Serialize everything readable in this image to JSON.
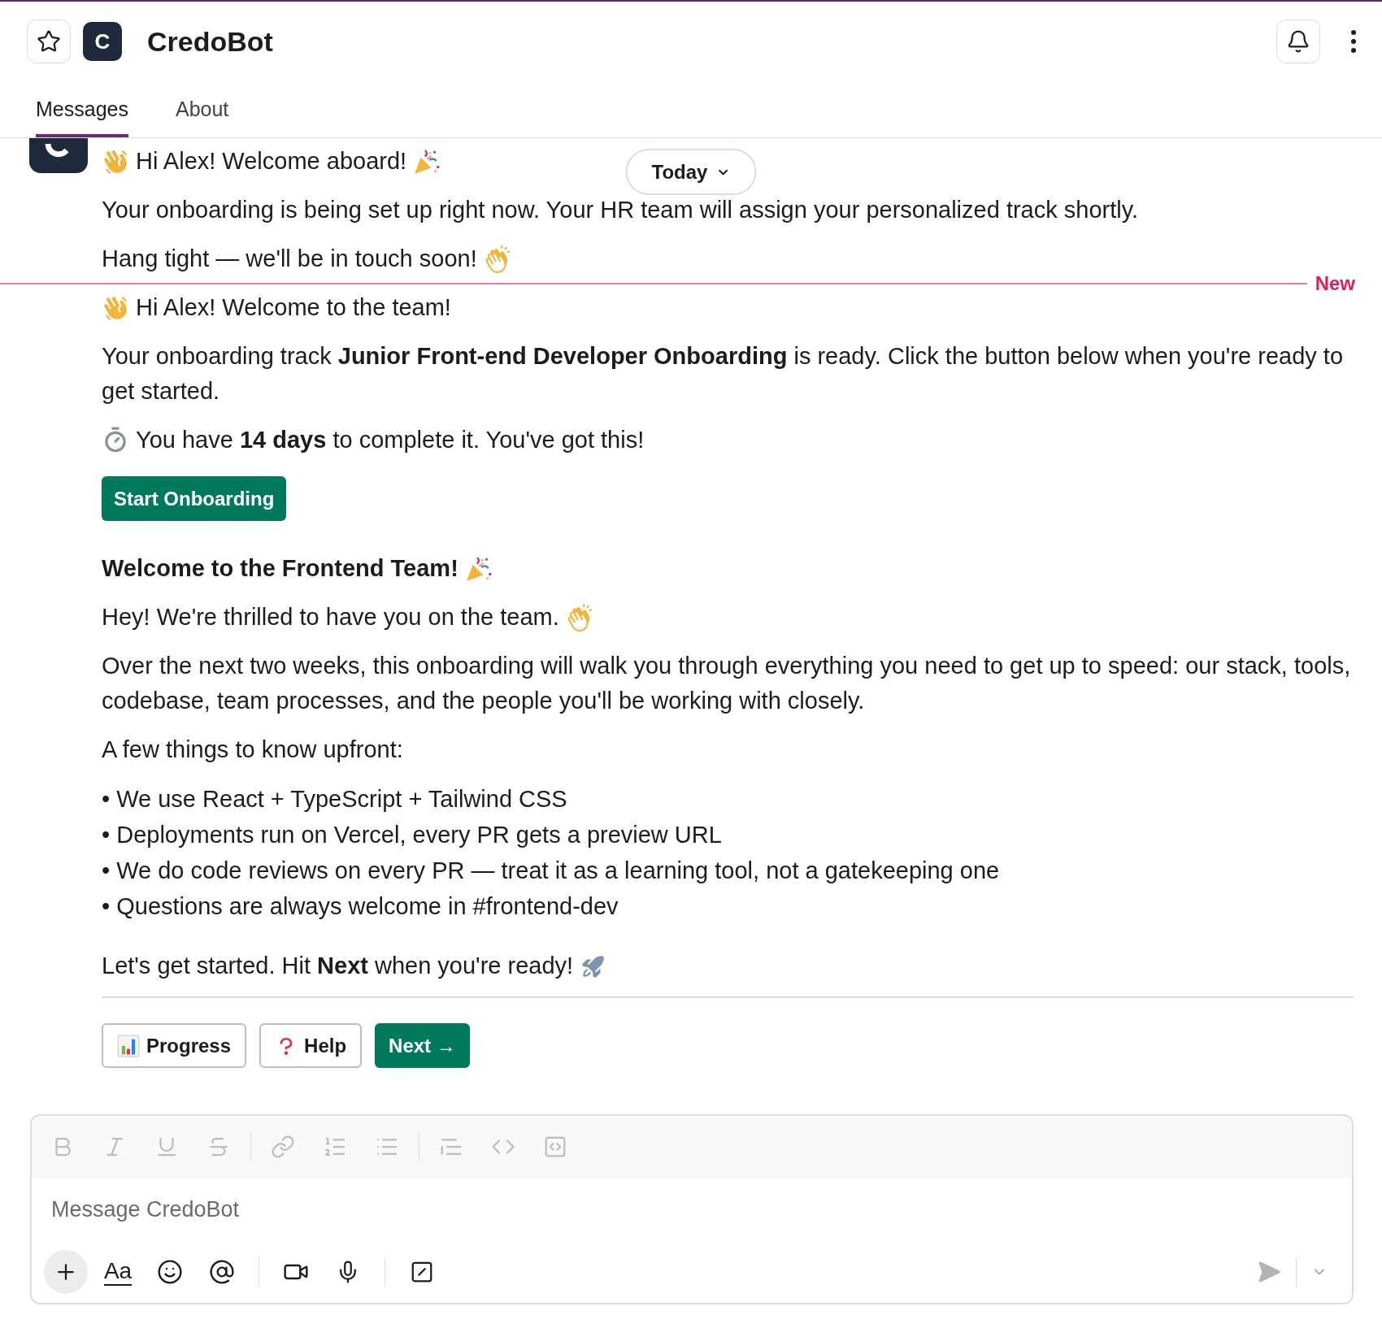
{
  "header": {
    "starred": false,
    "avatar_letter": "C",
    "title": "CredoBot"
  },
  "tabs": [
    {
      "label": "Messages",
      "selected": true
    },
    {
      "label": "About",
      "selected": false
    }
  ],
  "date_pill": {
    "label": "Today"
  },
  "earlier_message": {
    "avatar": true,
    "blocks": [
      {
        "kind": "welcome",
        "text": "Hi Alex! Welcome aboard!"
      },
      {
        "kind": "text",
        "text": "Your onboarding is being set up right now. Your HR team will assign your personalized track shortly."
      },
      {
        "kind": "cheer",
        "text": "Hang tight — we'll be in touch soon!"
      }
    ]
  },
  "new_divider": {
    "label": "New"
  },
  "new_message": {
    "avatar": false,
    "blocks": [
      {
        "kind": "greeting",
        "text": "Hi Alex! Welcome to the team!"
      },
      {
        "kind": "text",
        "text": "Your onboarding track **Junior Front-end Developer Onboarding** is ready. Click the button below when you're ready to get started."
      },
      {
        "kind": "timer",
        "text": "You have **14 days** to complete it. You've got this!"
      },
      {
        "kind": "button",
        "text": "Start Onboarding"
      },
      {
        "kind": "heading",
        "text": "Welcome to the Frontend Team!"
      },
      {
        "kind": "cheer",
        "text": "Hey! We're thrilled to have you on the team."
      },
      {
        "kind": "text",
        "text": "Over the next two weeks, this onboarding will walk you through everything you need to get up to speed: our stack, tools, codebase, team processes, and the people you'll be working with closely."
      },
      {
        "kind": "text",
        "text": "A few things to know upfront:"
      },
      {
        "kind": "list",
        "items": [
          "• We use React + TypeScript + Tailwind CSS",
          "• Deployments run on Vercel, every PR gets a preview URL",
          "• We do code reviews on every PR — treat it as a learning tool, not a gatekeeping one",
          "• Questions are always welcome in #frontend-dev"
        ]
      },
      {
        "kind": "closing",
        "text": "Let's get started. Hit **Next** when you're ready!"
      }
    ]
  },
  "actions": [
    {
      "label": "Progress",
      "kind": "outline"
    },
    {
      "label": "Help",
      "kind": "outline"
    },
    {
      "label": "Next →",
      "kind": "primary"
    }
  ],
  "composer": {
    "formatting_disabled": true,
    "placeholder": "Message CredoBot",
    "format_label": "Aa",
    "send_disabled": true
  }
}
